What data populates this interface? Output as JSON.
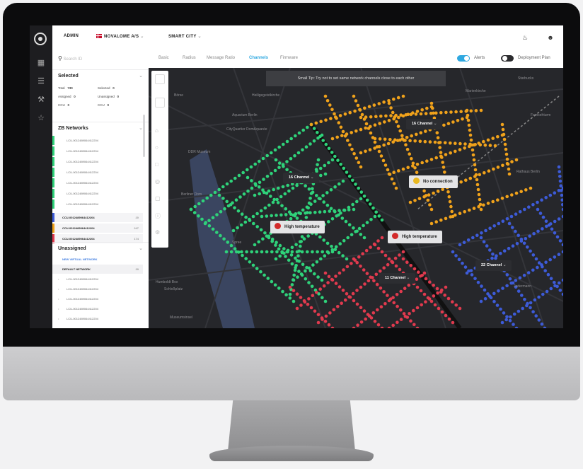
{
  "header": {
    "role": "ADMIN",
    "org": "NOVALOME A/S",
    "project": "SMART CITY"
  },
  "sidebar": {
    "search_placeholder": "Search ID",
    "selected": {
      "title": "Selected",
      "stats": [
        {
          "label": "Total",
          "value": "730"
        },
        {
          "label": "Selected",
          "value": "0"
        },
        {
          "label": "Assigned",
          "value": "0"
        },
        {
          "label": "Unassigned",
          "value": "0"
        },
        {
          "label": "CCU",
          "value": "0"
        },
        {
          "label": "CCU",
          "value": "0"
        }
      ]
    },
    "networks": {
      "title": "ZB Networks",
      "lcu_items": [
        "LCU-0012489064412204",
        "LCU-0012489064412204",
        "LCU-0012489064412204",
        "LCU-0012489064412204",
        "LCU-0012489064412204",
        "LCU-0012489064412204",
        "LCU-0012489064412204"
      ],
      "ccu_items": [
        {
          "label": "CCU-0012489064412204",
          "count": "20",
          "color": "#3d5bd8"
        },
        {
          "label": "CCU-0012489064412204",
          "count": "247",
          "color": "#f0a21b"
        },
        {
          "label": "CCU-0012489064412204",
          "count": "174",
          "color": "#e03a4e"
        }
      ]
    },
    "unassigned": {
      "title": "Unassigned",
      "new_network": "NEW VIRTUAL NETWORK",
      "default_network": "DEFAULT NETWORK",
      "default_count": "39",
      "items": [
        "LCU-0012489064412204",
        "LCU-0012489064412204",
        "LCU-0012489064412204",
        "LCU-0012489064412204",
        "LCU-0012489064412204"
      ]
    }
  },
  "tabs": {
    "items": [
      "Basic",
      "Radius",
      "Message Ratio",
      "Channels",
      "Firmware"
    ],
    "active": "Channels"
  },
  "toggles": {
    "alerts": {
      "label": "Alerts",
      "on": true
    },
    "deployment": {
      "label": "Deployment Plan",
      "on": false
    }
  },
  "map": {
    "tip": "Small Tip: Try not to set same network channels close to each other",
    "channels": [
      "16 Channel",
      "16 Channel",
      "11 Channel",
      "22 Channel"
    ],
    "alerts": [
      {
        "label": "No connection",
        "color": "#e8b820"
      },
      {
        "label": "High temperature",
        "color": "#d32a2a"
      },
      {
        "label": "High temperature",
        "color": "#d32a2a"
      }
    ],
    "places": [
      "Heiligegeistkirche",
      "Aquarium Berlin",
      "CityQuartier DomAquarée",
      "DDR Museum",
      "Berliner Dom",
      "Humboldt Box",
      "Schloßplatz",
      "Museumsinsel",
      "Starbucks",
      "Marienkirche",
      "Jedermann",
      "Rathaus Berlin",
      "Fernsehturm",
      "Spree",
      "Börse"
    ],
    "colors": {
      "green": "#2fd27a",
      "orange": "#f0a21b",
      "red": "#e03a4e",
      "blue": "#3d5bd8"
    }
  }
}
